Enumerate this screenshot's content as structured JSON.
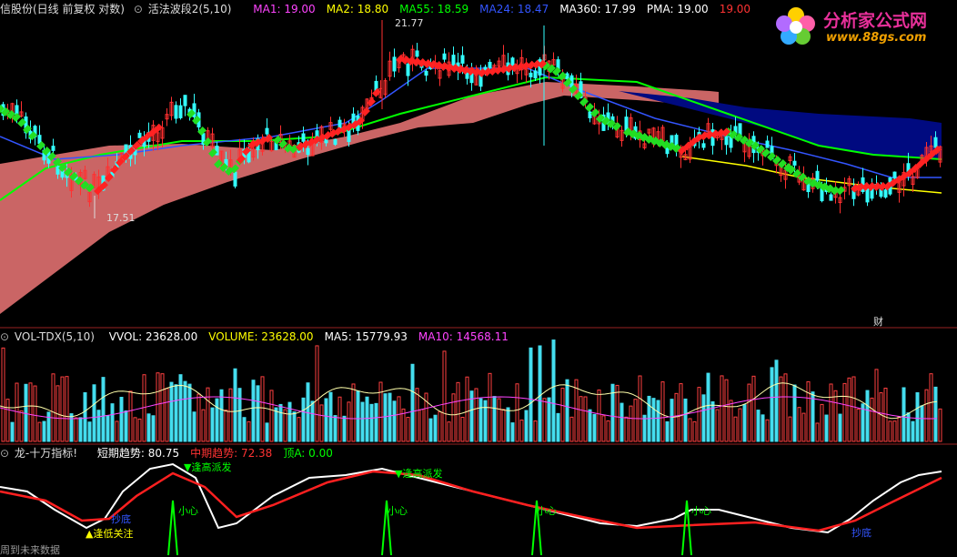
{
  "main": {
    "stock": "信股份(日线 前复权 对数)",
    "indicator": "活法波段2(5,10)",
    "ma": [
      {
        "label": "MA1: 19.00",
        "color": "#ff44ff"
      },
      {
        "label": "MA2: 18.80",
        "color": "#ffff00"
      },
      {
        "label": "MA55: 18.59",
        "color": "#00ff00"
      },
      {
        "label": "MA24: 18.47",
        "color": "#3355ff"
      },
      {
        "label": "MA360: 17.99",
        "color": "#ffffff"
      },
      {
        "label": "PMA: 19.00",
        "color": "#ffffff"
      },
      {
        "label": "19.00",
        "color": "#ff3333"
      }
    ],
    "high_label": "21.77",
    "low_label": "17.51",
    "fin_marker": "财"
  },
  "vol": {
    "name": "VOL-TDX(5,10)",
    "items": [
      {
        "label": "VVOL: 23628.00",
        "color": "#ffffff"
      },
      {
        "label": "VOLUME: 23628.00",
        "color": "#ffff00"
      },
      {
        "label": "MA5: 15779.93",
        "color": "#ffffff"
      },
      {
        "label": "MA10: 14568.11",
        "color": "#ff44ff"
      }
    ]
  },
  "sub": {
    "name": "龙-十万指标!",
    "items": [
      {
        "label": "短期趋势: 80.75",
        "color": "#ffffff"
      },
      {
        "label": "中期趋势: 72.38",
        "color": "#ff3333"
      },
      {
        "label": "顶A: 0.00",
        "color": "#00ff00"
      }
    ],
    "tags": {
      "high1": "▼逢高派发",
      "high2": "▼逢高派发",
      "buy1": "抄底",
      "buy2": "抄底",
      "watch": "▲逢低关注",
      "careful": "小心",
      "future": "周到未来数据"
    }
  },
  "logo": {
    "title": "分析家公式网",
    "url": "www.88gs.com"
  }
}
